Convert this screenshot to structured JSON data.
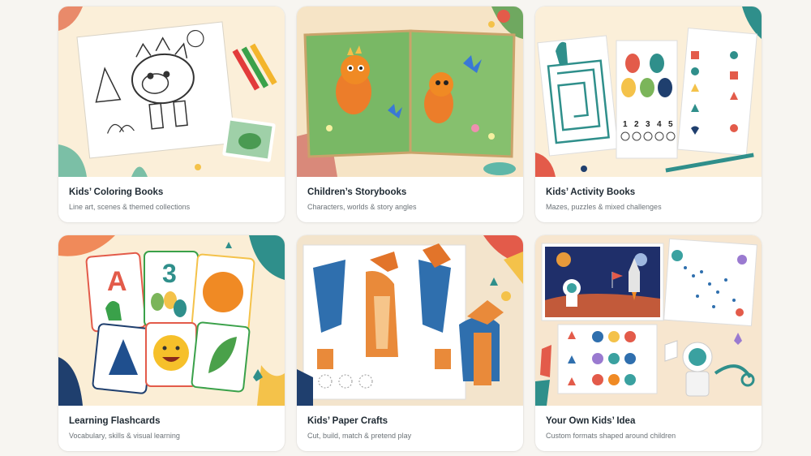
{
  "cards": [
    {
      "title": "Kids’ Coloring Books",
      "subtitle": "Line art, scenes & themed collections",
      "thumb_icon": "coloring-book-illustration"
    },
    {
      "title": "Children’s Storybooks",
      "subtitle": "Characters, worlds & story angles",
      "thumb_icon": "storybook-illustration"
    },
    {
      "title": "Kids’ Activity Books",
      "subtitle": "Mazes, puzzles & mixed challenges",
      "thumb_icon": "activity-book-illustration"
    },
    {
      "title": "Learning Flashcards",
      "subtitle": "Vocabulary, skills & visual learning",
      "thumb_icon": "flashcards-illustration"
    },
    {
      "title": "Kids’ Paper Crafts",
      "subtitle": "Cut, build, match & pretend play",
      "thumb_icon": "paper-craft-illustration"
    },
    {
      "title": "Your Own Kids’ Idea",
      "subtitle": "Custom formats shaped around children",
      "thumb_icon": "custom-idea-illustration"
    }
  ],
  "activity_numbers": [
    "1",
    "2",
    "3",
    "4",
    "5"
  ],
  "flashcards": {
    "letter": "A",
    "number": "3"
  },
  "colors": {
    "title": "#1f2a33",
    "subtitle": "#6c7378",
    "background": "#f7f5f1",
    "teal": "#2f8f8b",
    "orange": "#f08a24"
  }
}
